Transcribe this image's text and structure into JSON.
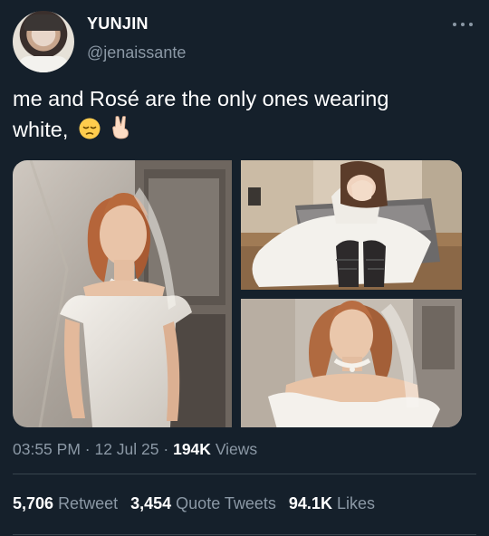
{
  "user": {
    "display_name": "YUNJIN",
    "handle": "@jenaissante"
  },
  "tweet": {
    "line1": "me and Rosé are the only ones wearing",
    "line2": "white,",
    "emojis": [
      "pensive-face",
      "victory-hand"
    ]
  },
  "media": {
    "count": 3,
    "photos": [
      "bride-standing-portrait",
      "bride-seated-covering-face",
      "bride-closeup-pearl-choker"
    ]
  },
  "meta": {
    "time": "03:55 PM",
    "date": "12 Jul 25",
    "separator": "·",
    "views_count": "194K",
    "views_label": "Views"
  },
  "stats": {
    "retweets_count": "5,706",
    "retweets_label": "Retweet",
    "quotes_count": "3,454",
    "quotes_label": "Quote Tweets",
    "likes_count": "94.1K",
    "likes_label": "Likes"
  },
  "colors": {
    "background": "#15202b",
    "secondary_text": "#8b98a5",
    "divider": "#38444d"
  }
}
